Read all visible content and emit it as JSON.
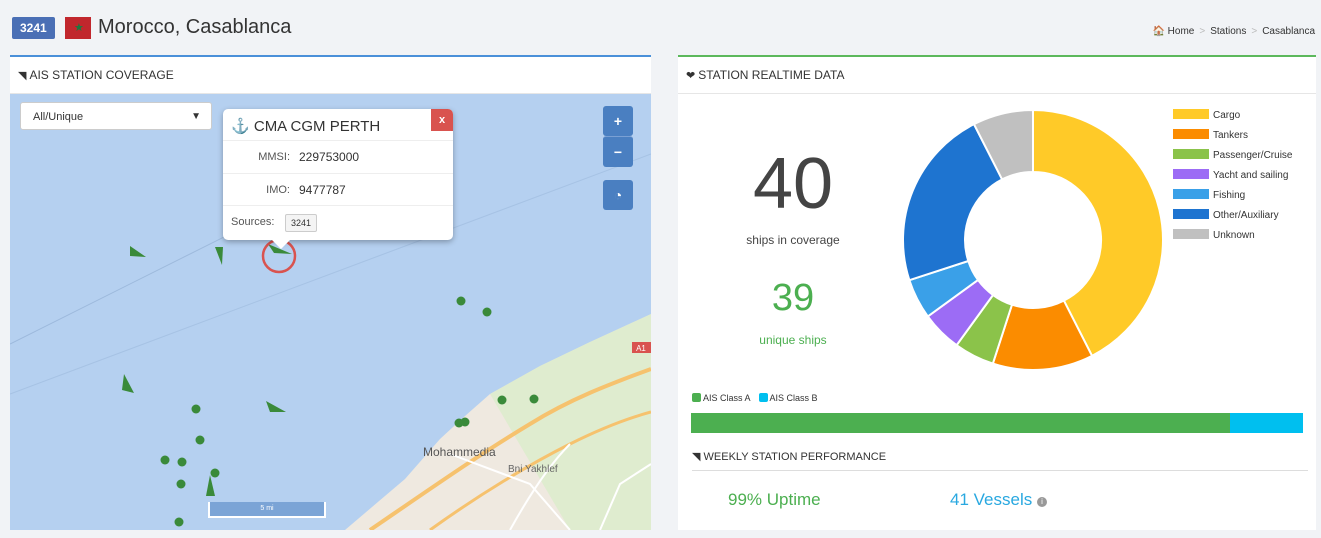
{
  "header": {
    "station_id": "3241",
    "title": "Morocco, Casablanca",
    "breadcrumb": [
      "Home",
      "Stations",
      "Casablanca"
    ]
  },
  "coverage_panel": {
    "title": "AIS STATION COVERAGE",
    "filter": {
      "selected": "All/Unique"
    },
    "zoom_in": "+",
    "zoom_out": "−",
    "popup": {
      "vessel_name": "CMA CGM PERTH",
      "close_label": "x",
      "mmsi_label": "MMSI:",
      "mmsi": "229753000",
      "imo_label": "IMO:",
      "imo": "9477787",
      "sources_label": "Sources:",
      "source": "3241"
    },
    "map_labels": {
      "city": "Mohammedia",
      "town": "Bni Yakhlef",
      "road": "A1",
      "scale": "5 mi"
    }
  },
  "realtime_panel": {
    "title": "STATION REALTIME DATA",
    "ships_in_coverage": "40",
    "ships_in_coverage_label": "ships in coverage",
    "unique_ships": "39",
    "unique_ships_label": "unique ships",
    "class_a_label": "AIS Class A",
    "class_b_label": "AIS Class B",
    "class_a_fraction": 0.88,
    "weekly_title": "WEEKLY STATION PERFORMANCE",
    "uptime": "99% Uptime",
    "vessels": "41 Vessels"
  },
  "chart_data": {
    "type": "pie",
    "categories": [
      "Cargo",
      "Tankers",
      "Passenger/Cruise",
      "Yacht and sailing",
      "Fishing",
      "Other/Auxiliary",
      "Unknown"
    ],
    "values": [
      17,
      5,
      2,
      2,
      2,
      9,
      3
    ],
    "colors": [
      "#ffca28",
      "#fb8c00",
      "#8bc34a",
      "#9c6cf5",
      "#3aa0e8",
      "#1e74d0",
      "#c0c0c0"
    ],
    "legend_position": "right"
  },
  "colors": {
    "class_a": "#4caf50",
    "class_b": "#00bfef",
    "accent": "#4a6fb5",
    "close": "#d9534f"
  }
}
